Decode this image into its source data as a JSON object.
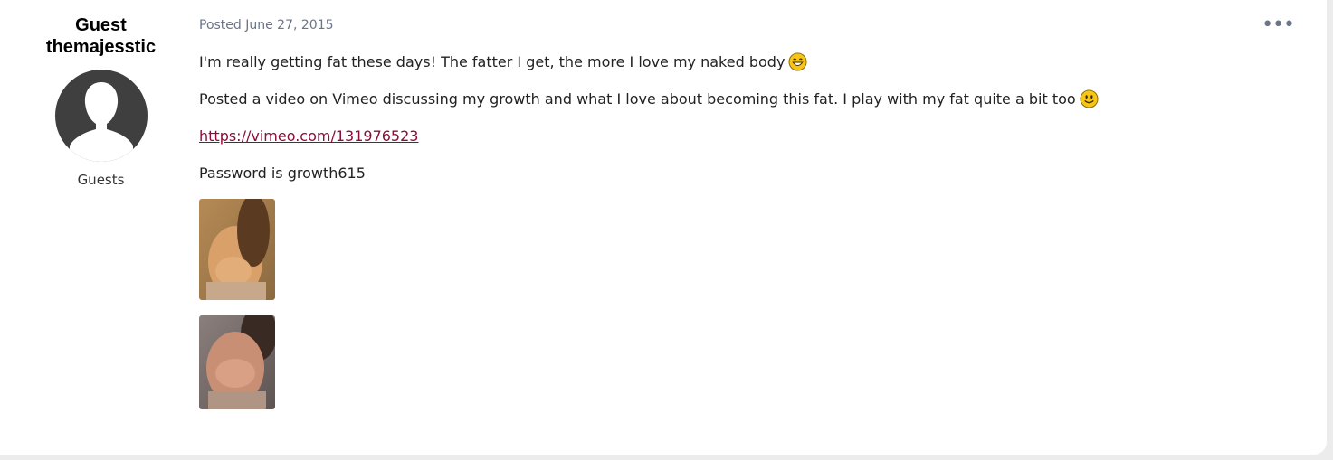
{
  "author": {
    "name_line1": "Guest",
    "name_line2": "themajesstic",
    "group": "Guests",
    "avatar": "default-person-avatar"
  },
  "post": {
    "meta": "Posted June 27, 2015",
    "more_icon": "ellipsis-icon",
    "paragraphs": {
      "p1": "I'm really getting fat these days! The fatter I get, the more I love my naked body",
      "p2": "Posted a video on Vimeo discussing my growth and what I love about becoming this fat. I play with my fat quite a bit too",
      "link": "https://vimeo.com/131976523",
      "p4": "Password is growth615"
    },
    "emojis": [
      "grin-emoji-icon",
      "smile-emoji-icon"
    ],
    "attachments": [
      "photo-attachment-1",
      "photo-attachment-2"
    ]
  },
  "colors": {
    "link": "#8a0e3a",
    "meta": "#6b7488",
    "avatar_bg": "#3f3f3f",
    "emoji": "#f5c518"
  }
}
